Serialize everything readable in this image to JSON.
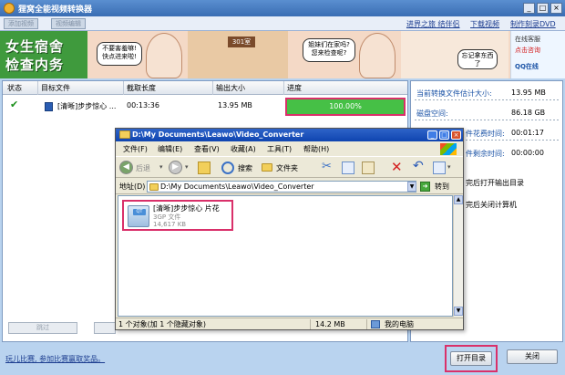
{
  "window": {
    "title": "狸窝全能视频转换器"
  },
  "toolbar": {
    "add_video": "添加视频",
    "edit_video": "视频编辑",
    "links": [
      "进界之旅 结伴侣",
      "下载视频",
      "制作刻录DVD"
    ]
  },
  "banner": {
    "title_line1": "女生宿舍",
    "title_line2": "检查内务",
    "bubble1": "不要害羞嘛!快点进来啦!",
    "room_number": "301室",
    "bubble2": "姐妹们在家吗?您来检查呢?",
    "bubble3": "忘记拿东西了",
    "service_label": "在线客服",
    "service_link": "点击咨询",
    "qq_label": "QQ在线"
  },
  "table": {
    "headers": [
      "状态",
      "目标文件",
      "截取长度",
      "输出大小",
      "进度"
    ],
    "rows": [
      {
        "file": "[清晰]步步惊心 ...",
        "duration": "00:13:36",
        "size": "13.95 MB",
        "progress": "100.00%"
      }
    ]
  },
  "left_buttons": {
    "skip": "跳过"
  },
  "info": {
    "items": [
      {
        "label": "当前转换文件估计大小:",
        "value": "13.95 MB"
      },
      {
        "label": "磁盘空间:",
        "value": "86.18 GB"
      },
      {
        "label": "件花费时间:",
        "value": "00:01:17"
      },
      {
        "label": "件剩余时间:",
        "value": "00:00:00"
      }
    ],
    "option1": "完后打开输出目录",
    "option2": "完后关闭计算机"
  },
  "footer": {
    "link": "玩儿比赛, 参加比赛赢取奖品。",
    "open_dir": "打开目录",
    "close": "关闭"
  },
  "explorer": {
    "title": "D:\\My Documents\\Leawo\\Video_Converter",
    "menu": [
      "文件(F)",
      "编辑(E)",
      "查看(V)",
      "收藏(A)",
      "工具(T)",
      "帮助(H)"
    ],
    "back": "后退",
    "search": "搜索",
    "folders": "文件夹",
    "address_label": "地址(D)",
    "address": "D:\\My Documents\\Leawo\\Video_Converter",
    "go": "转到",
    "file": {
      "name": "[清晰]步步惊心 片花",
      "type": "3GP 文件",
      "size": "14,617 KB",
      "badge": "QT"
    },
    "status": {
      "objects": "1 个对象(加 1 个隐藏对象)",
      "size": "14.2 MB",
      "location": "我的电脑"
    }
  },
  "colors": {
    "highlight": "#d9306a",
    "progress": "#46c046",
    "xp_title": "#0f45b0"
  }
}
